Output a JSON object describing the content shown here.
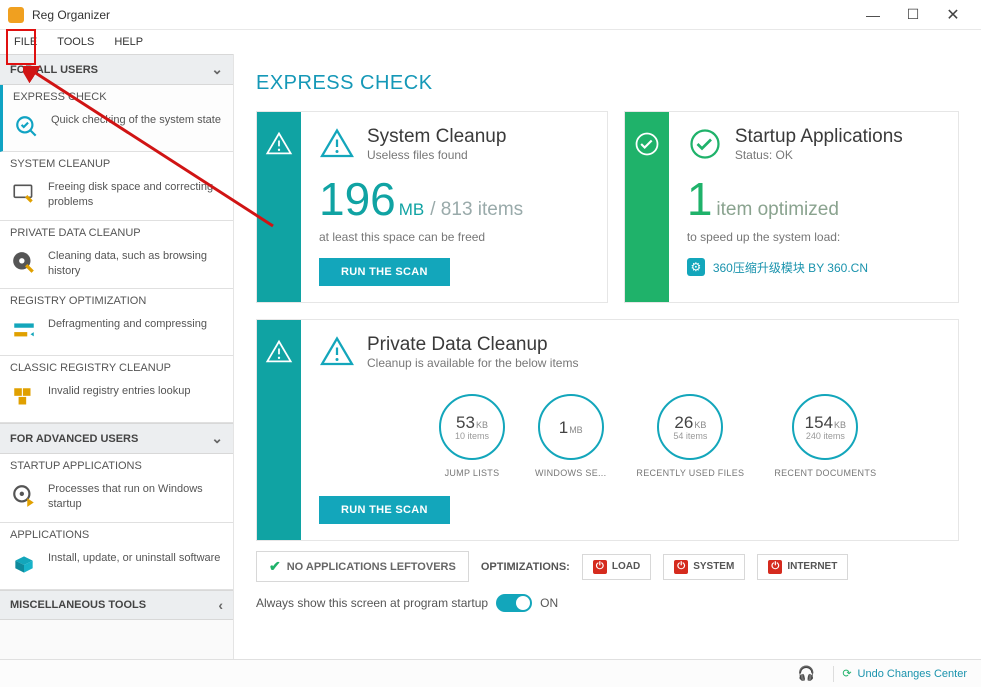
{
  "window": {
    "title": "Reg Organizer"
  },
  "menu": {
    "file": "FILE",
    "tools": "TOOLS",
    "help": "HELP"
  },
  "sidebar": {
    "group_all": "FOR ALL USERS",
    "group_adv": "FOR ADVANCED USERS",
    "group_misc": "MISCELLANEOUS TOOLS",
    "express": {
      "title": "EXPRESS CHECK",
      "desc": "Quick checking of the system state"
    },
    "cleanup": {
      "title": "SYSTEM CLEANUP",
      "desc": "Freeing disk space and correcting problems"
    },
    "private": {
      "title": "PRIVATE DATA CLEANUP",
      "desc": "Cleaning data, such as browsing history"
    },
    "registry": {
      "title": "REGISTRY OPTIMIZATION",
      "desc": "Defragmenting and compressing"
    },
    "classic": {
      "title": "CLASSIC REGISTRY CLEANUP",
      "desc": "Invalid registry entries lookup"
    },
    "startup": {
      "title": "STARTUP APPLICATIONS",
      "desc": "Processes that run on Windows startup"
    },
    "apps": {
      "title": "APPLICATIONS",
      "desc": "Install, update, or uninstall software"
    }
  },
  "page": {
    "title": "EXPRESS CHECK"
  },
  "system_cleanup": {
    "title": "System Cleanup",
    "subtitle": "Useless files found",
    "value": "196",
    "unit": "MB",
    "items": "/ 813 items",
    "note": "at least this space can be freed",
    "button": "RUN THE SCAN"
  },
  "startup_apps": {
    "title": "Startup Applications",
    "subtitle": "Status: OK",
    "value": "1",
    "rest": "item optimized",
    "note": "to speed up the system load:",
    "chip": "360压缩升级模块 BY 360.CN"
  },
  "private_cleanup": {
    "title": "Private Data Cleanup",
    "subtitle": "Cleanup is available for the below items",
    "button": "RUN THE SCAN",
    "circles": [
      {
        "val": "53",
        "unit": "KB",
        "items": "10 items",
        "label": "JUMP LISTS"
      },
      {
        "val": "1",
        "unit": "MB",
        "items": "",
        "label": "WINDOWS SE..."
      },
      {
        "val": "26",
        "unit": "KB",
        "items": "54 items",
        "label": "RECENTLY USED FILES"
      },
      {
        "val": "154",
        "unit": "KB",
        "items": "240 items",
        "label": "RECENT DOCUMENTS"
      }
    ]
  },
  "bottom": {
    "no_leftovers": "NO APPLICATIONS LEFTOVERS",
    "optimizations": "OPTIMIZATIONS:",
    "load": "LOAD",
    "system": "SYSTEM",
    "internet": "INTERNET",
    "always": "Always show this screen at program startup",
    "on": "ON"
  },
  "status": {
    "undo": "Undo Changes Center"
  }
}
